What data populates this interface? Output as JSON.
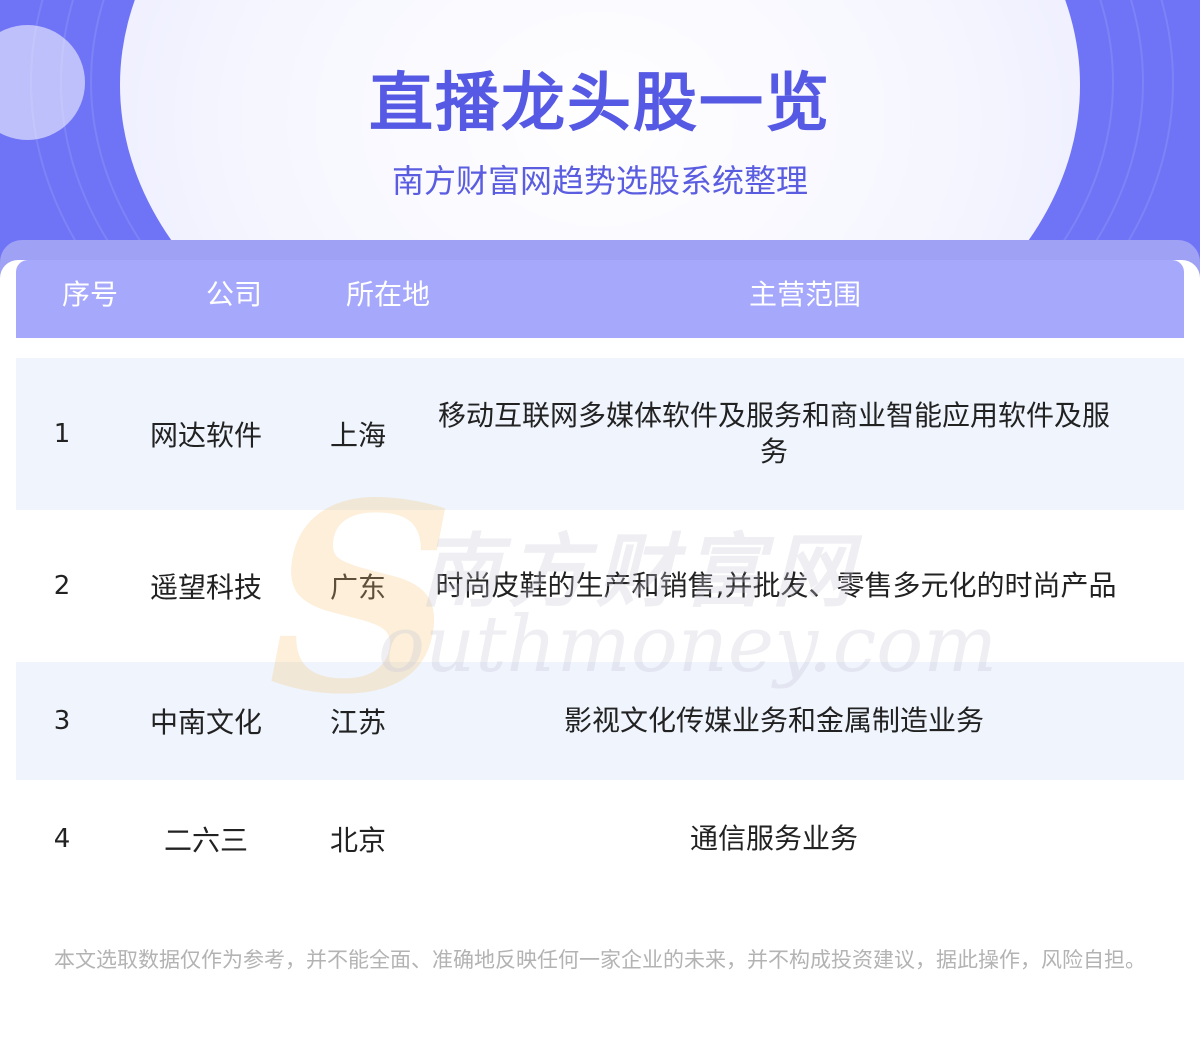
{
  "header": {
    "title": "直播龙头股一览",
    "subtitle": "南方财富网趋势选股系统整理"
  },
  "table": {
    "columns": [
      "序号",
      "公司",
      "所在地",
      "主营范围"
    ],
    "rows": [
      {
        "index": "1",
        "company": "网达软件",
        "location": "上海",
        "scope": "移动互联网多媒体软件及服务和商业智能应用软件及服务"
      },
      {
        "index": "2",
        "company": "遥望科技",
        "location": "广东",
        "scope": "时尚皮鞋的生产和销售,并批发、零售多元化的时尚产品"
      },
      {
        "index": "3",
        "company": "中南文化",
        "location": "江苏",
        "scope": "影视文化传媒业务和金属制造业务"
      },
      {
        "index": "4",
        "company": "二六三",
        "location": "北京",
        "scope": "通信服务业务"
      }
    ]
  },
  "watermark": {
    "letter": "S",
    "cn_text": "南方财富网",
    "en_text": "outhmoney.com"
  },
  "disclaimer": "本文选取数据仅作为参考，并不能全面、准确地反映任何一家企业的未来，并不构成投资建议，据此操作，风险自担。"
}
